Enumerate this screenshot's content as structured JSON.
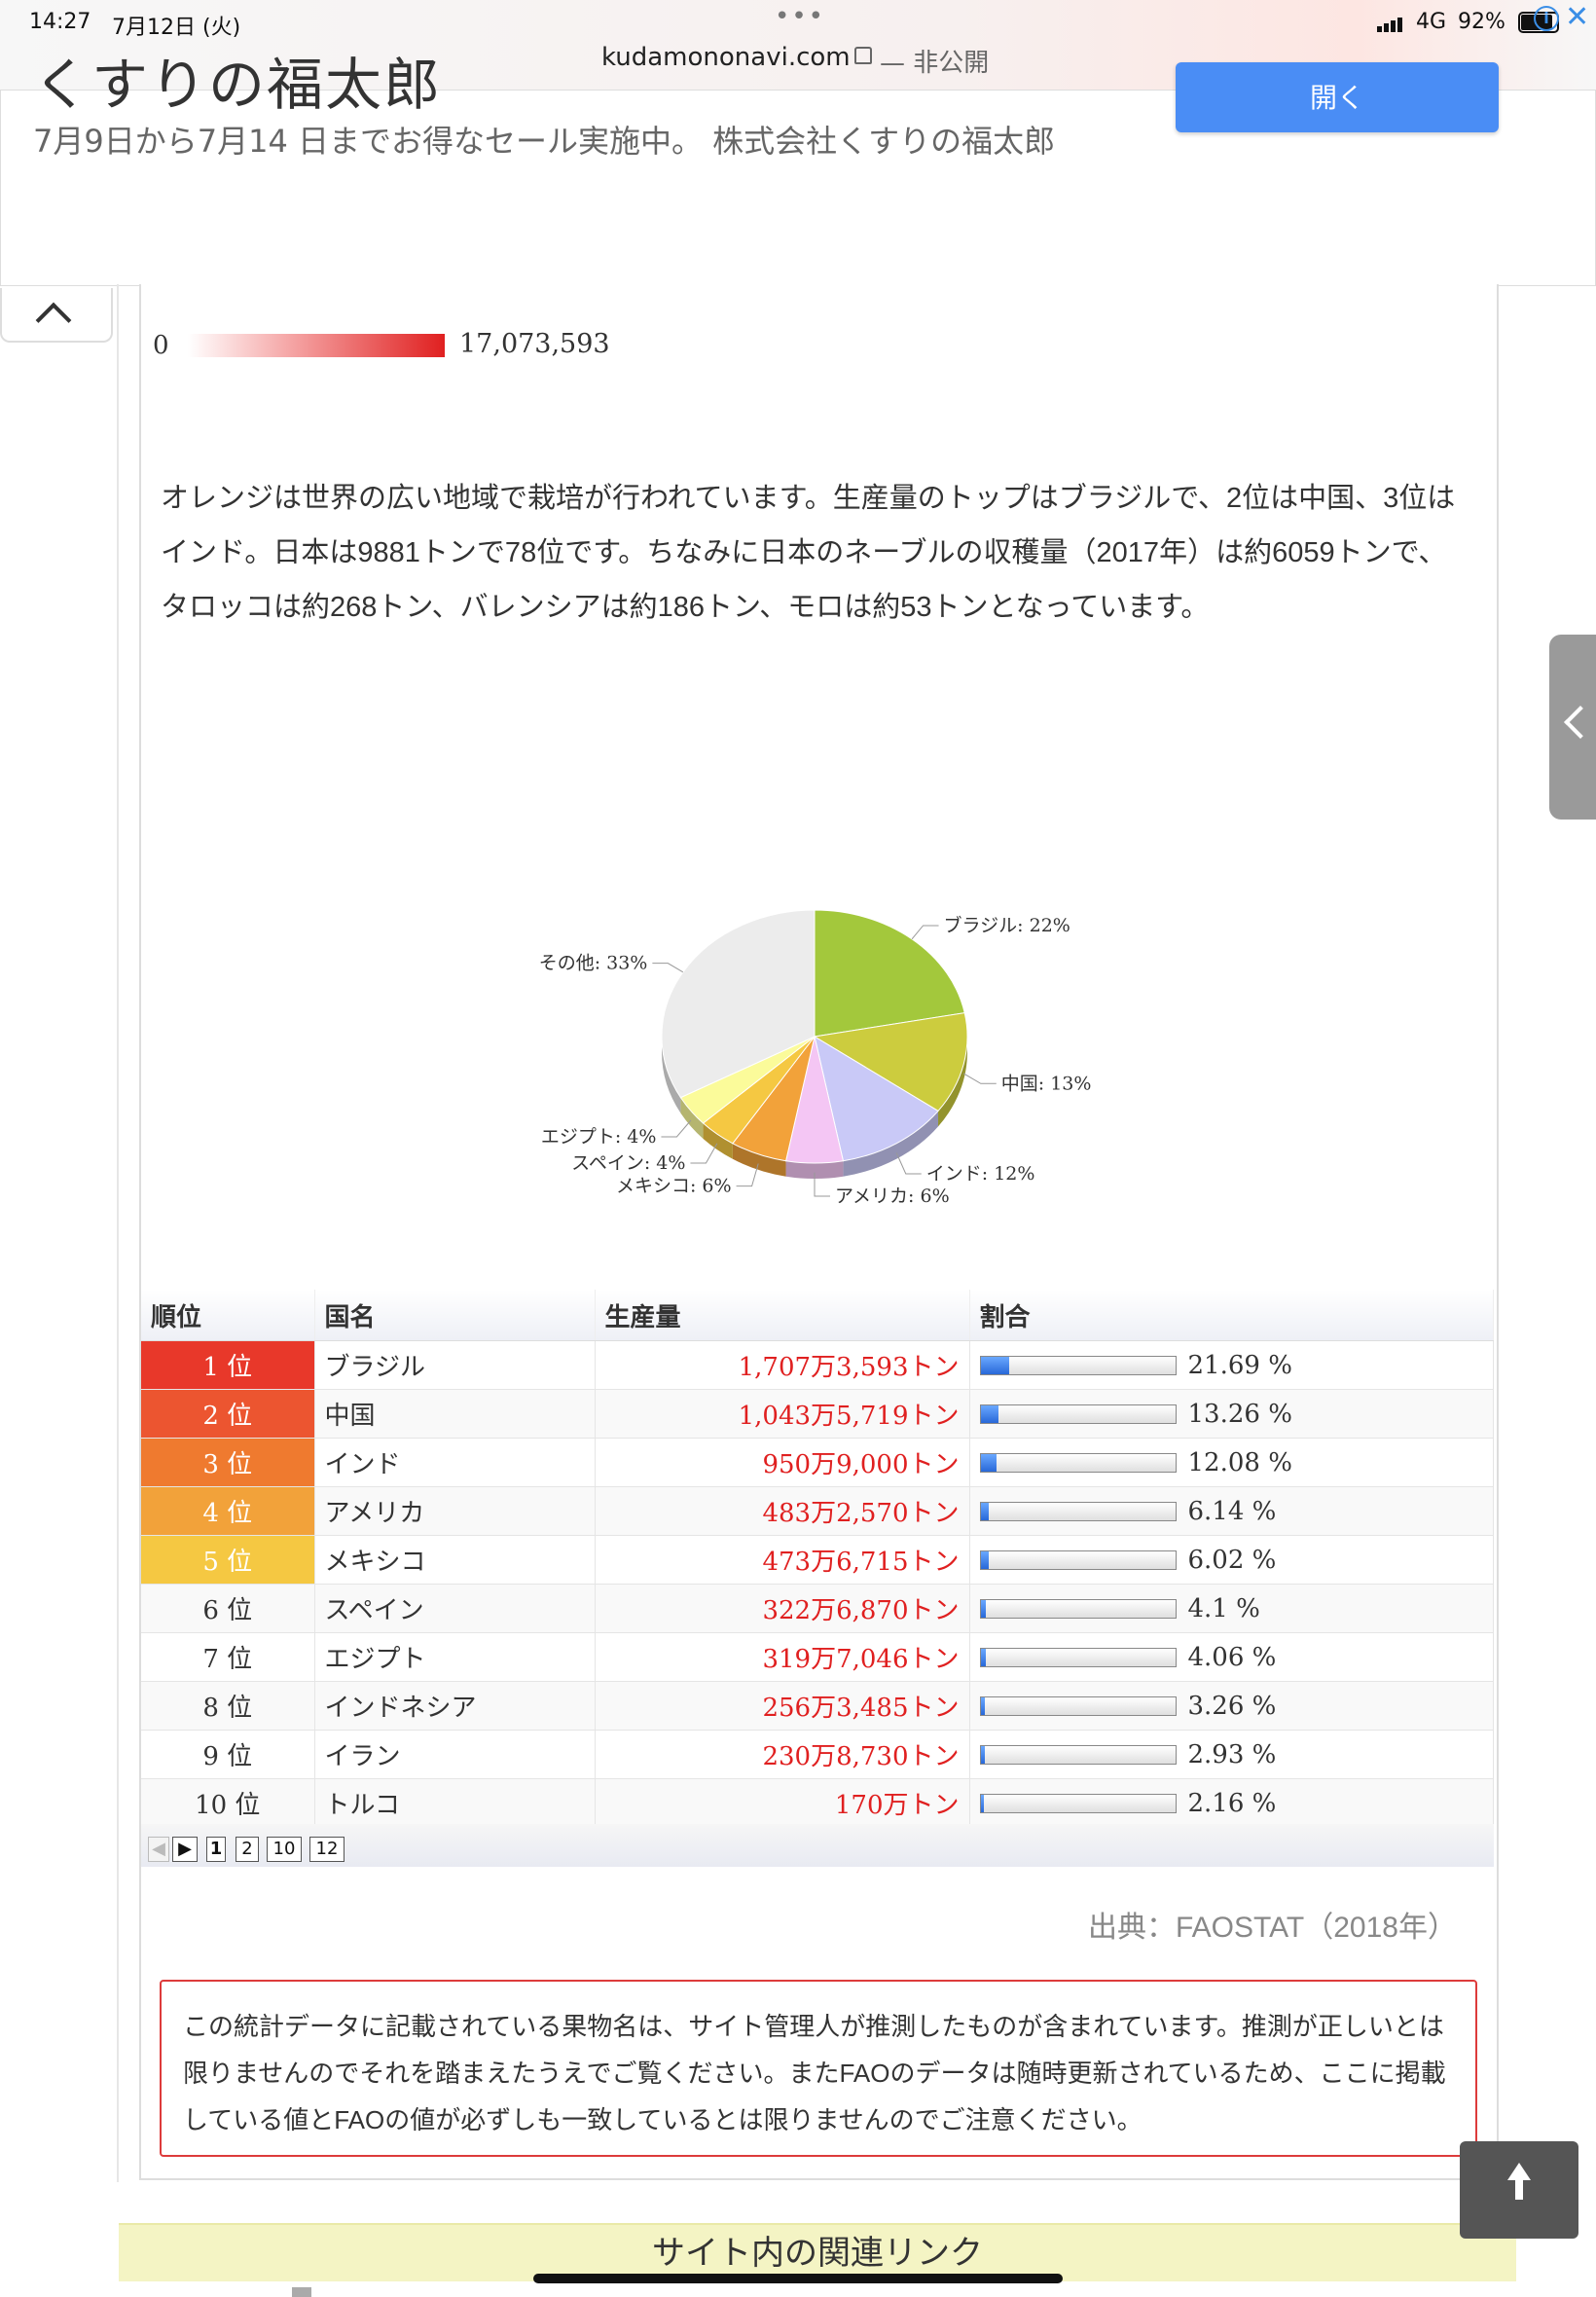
{
  "status_bar": {
    "time": "14:27",
    "date": "7月12日 (火)",
    "url": "kudamononavi.com",
    "private_label": "— 非公開",
    "network": "4G",
    "battery": "92%"
  },
  "ad": {
    "title": "くすりの福太郎",
    "description": "7月9日から7月14 日までお得なセール実施中。 株式会社くすりの福太郎",
    "open_button": "開く",
    "info_glyph": "i",
    "close_glyph": "✕"
  },
  "map_legend": {
    "min": "0",
    "max": "17,073,593"
  },
  "intro_text": "オレンジは世界の広い地域で栽培が行われています。生産量のトップはブラジルで、2位は中国、3位はインド。日本は9881トンで78位です。ちなみに日本のネーブルの収穫量（2017年）は約6059トンで、タロッコは約268トン、バレンシアは約186トン、モロは約53トンとなっています。",
  "chart_data": {
    "type": "pie",
    "slices": [
      {
        "label": "ブラジル: 22%",
        "value": 22,
        "color": "#a3c83c"
      },
      {
        "label": "中国: 13%",
        "value": 13,
        "color": "#cccc3e"
      },
      {
        "label": "インド: 12%",
        "value": 12,
        "color": "#c9c9f7"
      },
      {
        "label": "アメリカ: 6%",
        "value": 6,
        "color": "#f4c6f4"
      },
      {
        "label": "メキシコ: 6%",
        "value": 6,
        "color": "#f2a23a"
      },
      {
        "label": "スペイン: 4%",
        "value": 4,
        "color": "#f5c842"
      },
      {
        "label": "エジプト: 4%",
        "value": 4,
        "color": "#fbfb9a"
      },
      {
        "label": "その他: 33%",
        "value": 33,
        "color": "#ececec"
      }
    ]
  },
  "table": {
    "headers": [
      "順位",
      "国名",
      "生産量",
      "割合"
    ],
    "rows": [
      {
        "rank": "1 位",
        "country": "ブラジル",
        "production": "1,707万3,593トン",
        "share": 21.69,
        "share_text": "21.69 %",
        "color": "#e8382a"
      },
      {
        "rank": "2 位",
        "country": "中国",
        "production": "1,043万5,719トン",
        "share": 13.26,
        "share_text": "13.26 %",
        "color": "#ec5530"
      },
      {
        "rank": "3 位",
        "country": "インド",
        "production": "950万9,000トン",
        "share": 12.08,
        "share_text": "12.08 %",
        "color": "#ef7a2f"
      },
      {
        "rank": "4 位",
        "country": "アメリカ",
        "production": "483万2,570トン",
        "share": 6.14,
        "share_text": "6.14 %",
        "color": "#f2a23a"
      },
      {
        "rank": "5 位",
        "country": "メキシコ",
        "production": "473万6,715トン",
        "share": 6.02,
        "share_text": "6.02 %",
        "color": "#f5c842"
      },
      {
        "rank": "6 位",
        "country": "スペイン",
        "production": "322万6,870トン",
        "share": 4.1,
        "share_text": "4.1 %",
        "color": ""
      },
      {
        "rank": "7 位",
        "country": "エジプト",
        "production": "319万7,046トン",
        "share": 4.06,
        "share_text": "4.06 %",
        "color": ""
      },
      {
        "rank": "8 位",
        "country": "インドネシア",
        "production": "256万3,485トン",
        "share": 3.26,
        "share_text": "3.26 %",
        "color": ""
      },
      {
        "rank": "9 位",
        "country": "イラン",
        "production": "230万8,730トン",
        "share": 2.93,
        "share_text": "2.93 %",
        "color": ""
      },
      {
        "rank": "10 位",
        "country": "トルコ",
        "production": "170万トン",
        "share": 2.16,
        "share_text": "2.16 %",
        "color": ""
      }
    ]
  },
  "pager": {
    "prev": "◀",
    "next": "▶",
    "pages": [
      "1",
      "2",
      "10",
      "12"
    ]
  },
  "source": "出典：FAOSTAT（2018年）",
  "notice": "この統計データに記載されている果物名は、サイト管理人が推測したものが含まれています。推測が正しいとは限りませんのでそれを踏まえたうえでご覧ください。またFAOのデータは随時更新されているため、ここに掲載している値とFAOの値が必ずしも一致しているとは限りませんのでご注意ください。",
  "related_links_title": "サイト内の関連リンク",
  "icons": [
    "lock-icon",
    "signal-icon",
    "battery-icon",
    "info-icon",
    "close-icon",
    "chevron-up-icon",
    "chevron-left-icon",
    "arrow-up-icon"
  ]
}
